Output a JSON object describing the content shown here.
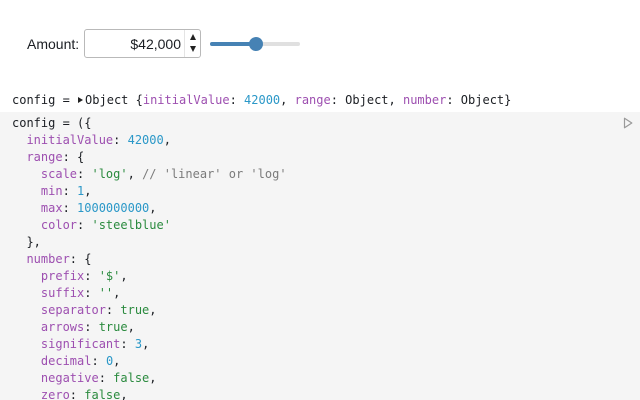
{
  "widget": {
    "label": "Amount:",
    "value_display": "$42,000",
    "slider": {
      "value": 42000,
      "min": 1,
      "max": 1000000000,
      "scale": "log",
      "color": "#4682b4"
    }
  },
  "inspector": {
    "name": "config",
    "eq": " = ",
    "type": "Object",
    "fields": [
      {
        "key": "initialValue",
        "value": "42000",
        "kind": "num"
      },
      {
        "key": "range",
        "value": "Object",
        "kind": "plain"
      },
      {
        "key": "number",
        "value": "Object",
        "kind": "plain"
      }
    ]
  },
  "code": {
    "lines": [
      [
        {
          "t": "config = ({",
          "c": "punc"
        }
      ],
      [
        {
          "t": "  initialValue",
          "c": "key"
        },
        {
          "t": ": ",
          "c": "punc"
        },
        {
          "t": "42000",
          "c": "num"
        },
        {
          "t": ",",
          "c": "punc"
        }
      ],
      [
        {
          "t": "  range",
          "c": "key"
        },
        {
          "t": ": {",
          "c": "punc"
        }
      ],
      [
        {
          "t": "    scale",
          "c": "key"
        },
        {
          "t": ": ",
          "c": "punc"
        },
        {
          "t": "'log'",
          "c": "str"
        },
        {
          "t": ", ",
          "c": "punc"
        },
        {
          "t": "// 'linear' or 'log'",
          "c": "com"
        }
      ],
      [
        {
          "t": "    min",
          "c": "key"
        },
        {
          "t": ": ",
          "c": "punc"
        },
        {
          "t": "1",
          "c": "num"
        },
        {
          "t": ",",
          "c": "punc"
        }
      ],
      [
        {
          "t": "    max",
          "c": "key"
        },
        {
          "t": ": ",
          "c": "punc"
        },
        {
          "t": "1000000000",
          "c": "num"
        },
        {
          "t": ",",
          "c": "punc"
        }
      ],
      [
        {
          "t": "    color",
          "c": "key"
        },
        {
          "t": ": ",
          "c": "punc"
        },
        {
          "t": "'steelblue'",
          "c": "str"
        }
      ],
      [
        {
          "t": "  },",
          "c": "punc"
        }
      ],
      [
        {
          "t": "  number",
          "c": "key"
        },
        {
          "t": ": {",
          "c": "punc"
        }
      ],
      [
        {
          "t": "    prefix",
          "c": "key"
        },
        {
          "t": ": ",
          "c": "punc"
        },
        {
          "t": "'$'",
          "c": "str"
        },
        {
          "t": ",",
          "c": "punc"
        }
      ],
      [
        {
          "t": "    suffix",
          "c": "key"
        },
        {
          "t": ": ",
          "c": "punc"
        },
        {
          "t": "''",
          "c": "str"
        },
        {
          "t": ",",
          "c": "punc"
        }
      ],
      [
        {
          "t": "    separator",
          "c": "key"
        },
        {
          "t": ": ",
          "c": "punc"
        },
        {
          "t": "true",
          "c": "str"
        },
        {
          "t": ",",
          "c": "punc"
        }
      ],
      [
        {
          "t": "    arrows",
          "c": "key"
        },
        {
          "t": ": ",
          "c": "punc"
        },
        {
          "t": "true",
          "c": "str"
        },
        {
          "t": ",",
          "c": "punc"
        }
      ],
      [
        {
          "t": "    significant",
          "c": "key"
        },
        {
          "t": ": ",
          "c": "punc"
        },
        {
          "t": "3",
          "c": "num"
        },
        {
          "t": ",",
          "c": "punc"
        }
      ],
      [
        {
          "t": "    decimal",
          "c": "key"
        },
        {
          "t": ": ",
          "c": "punc"
        },
        {
          "t": "0",
          "c": "num"
        },
        {
          "t": ",",
          "c": "punc"
        }
      ],
      [
        {
          "t": "    negative",
          "c": "key"
        },
        {
          "t": ": ",
          "c": "punc"
        },
        {
          "t": "false",
          "c": "str"
        },
        {
          "t": ",",
          "c": "punc"
        }
      ],
      [
        {
          "t": "    zero",
          "c": "key"
        },
        {
          "t": ": ",
          "c": "punc"
        },
        {
          "t": "false",
          "c": "str"
        },
        {
          "t": ",",
          "c": "punc"
        }
      ]
    ]
  },
  "icons": {
    "run": "play-outline-icon",
    "expand": "caret-right-icon",
    "stepper_up": "arrow-up-icon",
    "stepper_down": "arrow-down-icon"
  }
}
